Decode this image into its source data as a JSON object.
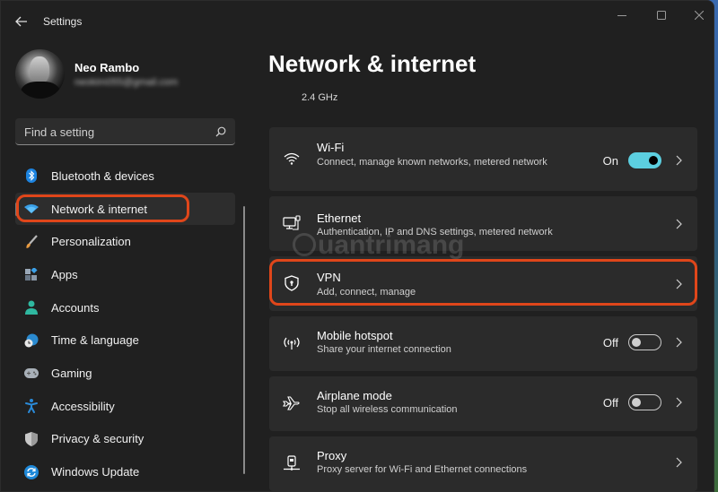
{
  "window": {
    "title": "Settings",
    "controls": {
      "minimize": "minimize",
      "maximize": "maximize",
      "close": "close"
    }
  },
  "profile": {
    "name": "Neo Rambo",
    "email": "neokim055@gmail.com"
  },
  "search": {
    "placeholder": "Find a setting"
  },
  "sidebar": {
    "items": [
      {
        "label": "Bluetooth & devices",
        "icon": "bluetooth-icon",
        "active": false
      },
      {
        "label": "Network & internet",
        "icon": "wifi-icon",
        "active": true
      },
      {
        "label": "Personalization",
        "icon": "brush-icon",
        "active": false
      },
      {
        "label": "Apps",
        "icon": "apps-icon",
        "active": false
      },
      {
        "label": "Accounts",
        "icon": "person-icon",
        "active": false
      },
      {
        "label": "Time & language",
        "icon": "clock-globe-icon",
        "active": false
      },
      {
        "label": "Gaming",
        "icon": "gamepad-icon",
        "active": false
      },
      {
        "label": "Accessibility",
        "icon": "accessibility-icon",
        "active": false
      },
      {
        "label": "Privacy & security",
        "icon": "shield-icon",
        "active": false
      },
      {
        "label": "Windows Update",
        "icon": "update-icon",
        "active": false
      }
    ]
  },
  "main": {
    "title": "Network & internet",
    "partial_text": "2.4 GHz",
    "cards": [
      {
        "title": "Wi-Fi",
        "subtitle": "Connect, manage known networks, metered network",
        "icon": "wifi-icon",
        "toggle": {
          "label": "On",
          "state": true
        }
      },
      {
        "title": "Ethernet",
        "subtitle": "Authentication, IP and DNS settings, metered network",
        "icon": "ethernet-icon"
      },
      {
        "title": "VPN",
        "subtitle": "Add, connect, manage",
        "icon": "vpn-shield-icon"
      },
      {
        "title": "Mobile hotspot",
        "subtitle": "Share your internet connection",
        "icon": "hotspot-icon",
        "toggle": {
          "label": "Off",
          "state": false
        }
      },
      {
        "title": "Airplane mode",
        "subtitle": "Stop all wireless communication",
        "icon": "airplane-icon",
        "toggle": {
          "label": "Off",
          "state": false
        }
      },
      {
        "title": "Proxy",
        "subtitle": "Proxy server for Wi-Fi and Ethernet connections",
        "icon": "proxy-icon"
      }
    ]
  },
  "watermark": "uantrimang",
  "colors": {
    "accent": "#5ccfe0",
    "highlight": "#e0461a",
    "window_bg": "#202020",
    "card_bg": "#2b2b2b"
  }
}
